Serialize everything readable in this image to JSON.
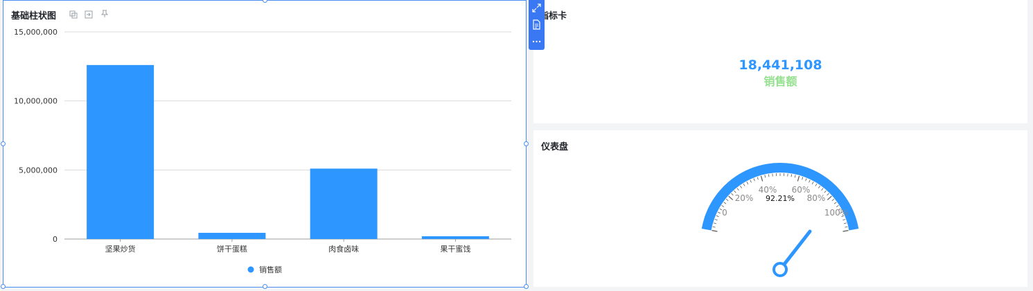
{
  "bar_chart_panel": {
    "title": "基础柱状图",
    "toolbar_icons": [
      "copy-icon",
      "export-icon",
      "pin-icon"
    ]
  },
  "floating_toolbar": {
    "icons": [
      "expand-icon",
      "document-icon",
      "more-icon"
    ]
  },
  "kpi_panel": {
    "title": "指标卡",
    "value": "18,441,108",
    "label": "销售额",
    "value_color": "#2e96ff",
    "label_color": "#94e08e"
  },
  "gauge_panel": {
    "title": "仪表盘",
    "value_percent": 92.21,
    "value_label": "92.21%",
    "tick_labels": [
      "0",
      "20%",
      "40%",
      "60%",
      "80%",
      "100%"
    ],
    "arc_color": "#2e96ff",
    "overflow_color": "#94e08e"
  },
  "chart_data": {
    "type": "bar",
    "title": "基础柱状图",
    "categories": [
      "坚果炒货",
      "饼干蛋糕",
      "肉食卤味",
      "果干蜜饯"
    ],
    "series": [
      {
        "name": "销售额",
        "values": [
          12600000,
          450000,
          5100000,
          200000
        ],
        "color": "#2e96ff"
      }
    ],
    "ylim": [
      0,
      15000000
    ],
    "y_ticks": [
      0,
      5000000,
      10000000,
      15000000
    ],
    "y_tick_labels": [
      "0",
      "5,000,000",
      "10,000,000",
      "15,000,000"
    ],
    "grid": true,
    "legend_position": "bottom-center"
  }
}
